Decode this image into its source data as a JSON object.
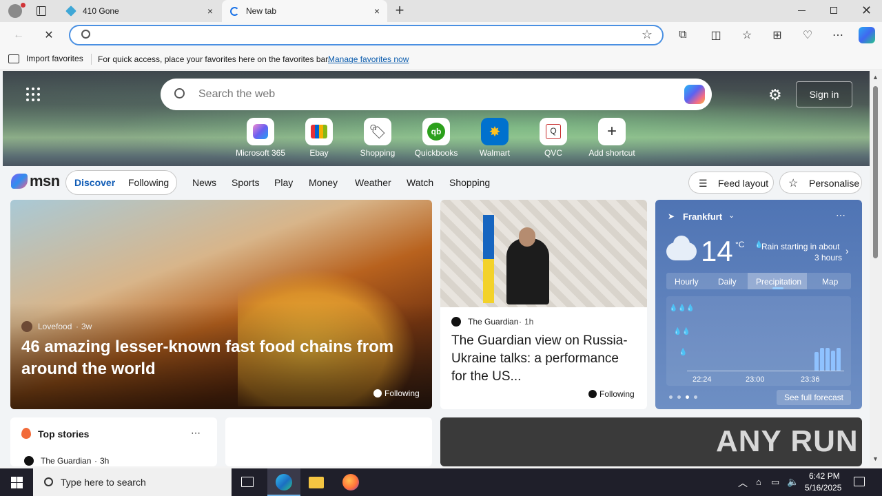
{
  "browser": {
    "tabs": [
      {
        "title": "410 Gone",
        "icon": "cube-icon"
      },
      {
        "title": "New tab",
        "icon": "loading-spinner-icon"
      }
    ],
    "address": {
      "value": "",
      "placeholder": ""
    },
    "favorites_bar": {
      "import_label": "Import favorites",
      "hint": "For quick access, place your favorites here on the favorites bar.",
      "manage_link": "Manage favorites now"
    }
  },
  "newtab": {
    "search_placeholder": "Search the web",
    "sign_in": "Sign in",
    "shortcuts": [
      {
        "label": "Microsoft 365",
        "icon": "m365-icon"
      },
      {
        "label": "Ebay",
        "icon": "ebay-icon"
      },
      {
        "label": "Shopping",
        "icon": "tag-icon"
      },
      {
        "label": "Quickbooks",
        "icon": "quickbooks-icon"
      },
      {
        "label": "Walmart",
        "icon": "walmart-icon"
      },
      {
        "label": "QVC",
        "icon": "qvc-icon"
      },
      {
        "label": "Add shortcut",
        "icon": "plus-icon"
      }
    ],
    "brand": "msn",
    "nav": {
      "discover": "Discover",
      "following": "Following",
      "items": [
        "News",
        "Sports",
        "Play",
        "Money",
        "Weather",
        "Watch",
        "Shopping"
      ],
      "feed_layout": "Feed layout",
      "personalise": "Personalise"
    },
    "hero_card": {
      "source": "Lovefood",
      "age": "3w",
      "title": "46 amazing lesser-known fast food chains from around the world",
      "following": "Following"
    },
    "news_card": {
      "source": "The Guardian",
      "age": "1h",
      "title": "The Guardian view on Russia-Ukraine talks: a performance for the US...",
      "following": "Following"
    },
    "weather": {
      "city": "Frankfurt",
      "temp": "14",
      "unit": "°C",
      "summary_line1": "Rain starting in about",
      "summary_line2": "3 hours",
      "tabs": [
        "Hourly",
        "Daily",
        "Precipitation",
        "Map"
      ],
      "active_tab": "Precipitation",
      "times": [
        "22:24",
        "23:00",
        "23:36"
      ],
      "bars": [
        0.42,
        0.5,
        0.5,
        0.45,
        0.5
      ],
      "see_forecast": "See full forecast"
    },
    "top_stories": {
      "title": "Top stories",
      "source": "The Guardian",
      "age": "3h"
    },
    "watermark": "ANY RUN"
  },
  "taskbar": {
    "search_placeholder": "Type here to search",
    "time": "6:42 PM",
    "date": "5/16/2025"
  }
}
